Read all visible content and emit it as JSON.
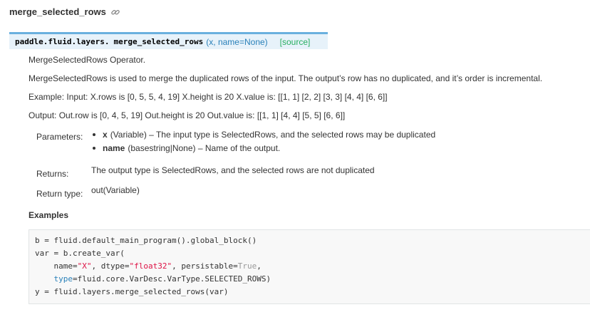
{
  "page": {
    "title": "merge_selected_rows"
  },
  "signature": {
    "module": "paddle.fluid.layers.",
    "function": "merge_selected_rows",
    "params": "(x, name=None)",
    "source": "[source]"
  },
  "description": {
    "line1": "MergeSelectedRows Operator.",
    "line2": "MergeSelectedRows is used to merge the duplicated rows of the input. The output’s row has no duplicated, and it’s order is incremental.",
    "line3": "Example: Input: X.rows is [0, 5, 5, 4, 19] X.height is 20 X.value is: [[1, 1] [2, 2] [3, 3] [4, 4] [6, 6]]",
    "line4": "Output: Out.row is [0, 4, 5, 19] Out.height is 20 Out.value is: [[1, 1] [4, 4] [5, 5] [6, 6]]"
  },
  "fields": {
    "parameters_label": "Parameters:",
    "param_x_name": "x",
    "param_x_desc": "(Variable) – The input type is SelectedRows, and the selected rows may be duplicated",
    "param_name_name": "name",
    "param_name_desc": "(basestring|None) – Name of the output.",
    "returns_label": "Returns:",
    "returns_desc": "The output type is SelectedRows, and the selected rows are not duplicated",
    "return_type_label": "Return type:",
    "return_type_desc": "out(Variable)"
  },
  "examples": {
    "heading": "Examples",
    "code": {
      "l1": "b = fluid.default_main_program().global_block()",
      "l2": "var = b.create_var(",
      "l3_a": "    name=",
      "l3_b": "\"X\"",
      "l3_c": ", dtype=",
      "l3_d": "\"float32\"",
      "l3_e": ", persistable=",
      "l3_f": "True",
      "l3_g": ",",
      "l4_a": "    ",
      "l4_b": "type",
      "l4_c": "=fluid.core.VarDesc.VarType.SELECTED_ROWS)",
      "l5": "y = fluid.layers.merge_selected_rows(var)"
    }
  },
  "colors": {
    "signature_bg": "#e7f2fa",
    "signature_border": "#6ab0de",
    "param_link": "#2980b9",
    "source_link": "#27ae60",
    "string": "#dd1144"
  }
}
